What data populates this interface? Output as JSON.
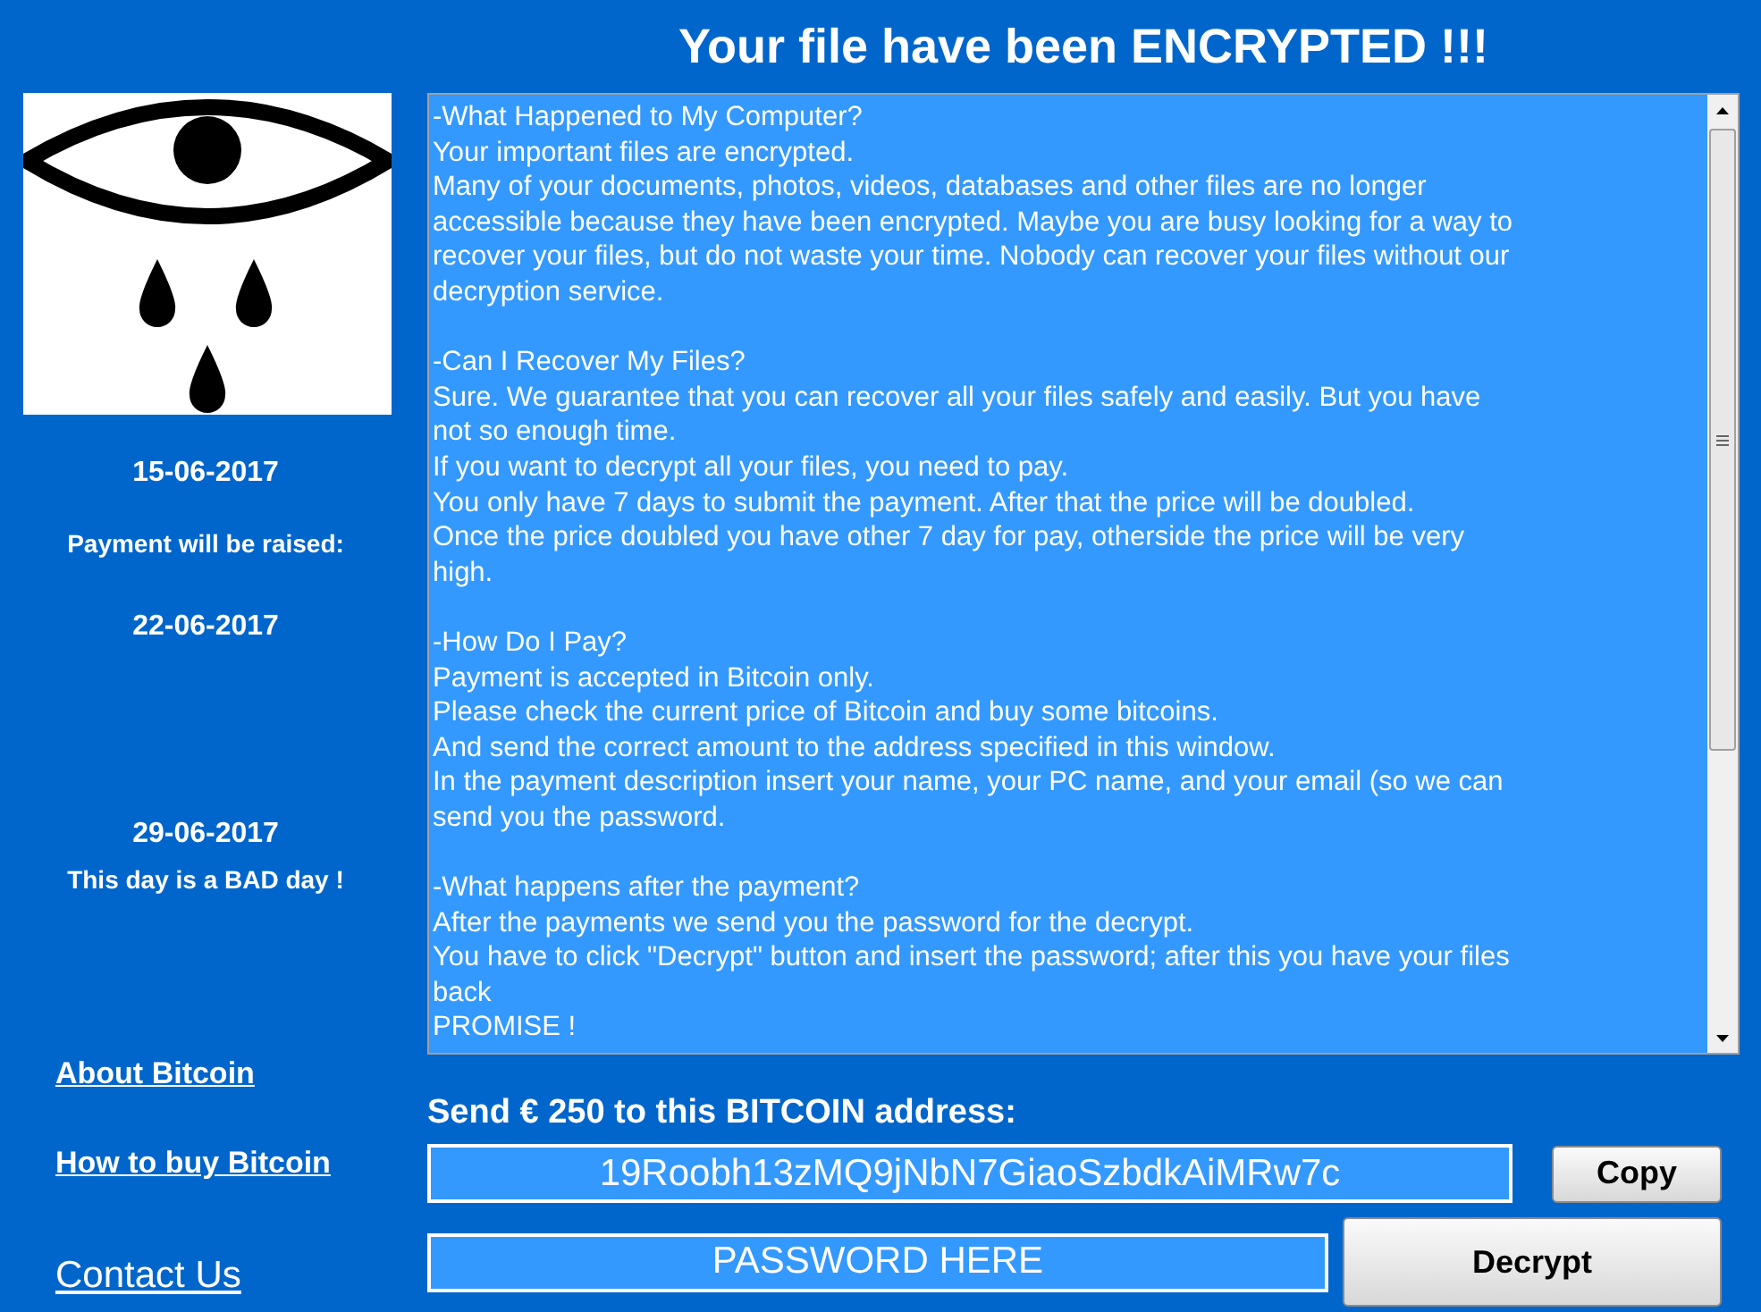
{
  "title": "Your file have been ENCRYPTED !!!",
  "sidebar": {
    "schedule": [
      {
        "kind": "date",
        "text": "15-06-2017"
      },
      {
        "kind": "note",
        "text": "Payment will be raised:"
      },
      {
        "kind": "date",
        "text": "22-06-2017"
      },
      {
        "kind": "date",
        "text": "29-06-2017"
      },
      {
        "kind": "note",
        "text": "This day is a BAD day !"
      }
    ],
    "links": [
      {
        "kind": "small",
        "text": "About Bitcoin"
      },
      {
        "kind": "small",
        "text": "How to buy Bitcoin"
      },
      {
        "kind": "large",
        "text": "Contact Us"
      }
    ]
  },
  "message": {
    "sections": [
      [
        "-What Happened to My Computer?",
        "Your important files are encrypted.",
        "Many of your documents, photos, videos, databases and other files are no longer",
        "accessible because they have been encrypted. Maybe you are busy looking for a way to",
        "recover your files, but do not waste your time. Nobody can recover your files without our",
        "decryption service."
      ],
      [
        "-Can I Recover My Files?",
        "Sure. We guarantee that you can recover all your files safely and easily. But you have",
        "not so enough time.",
        "If you want to decrypt all your files, you need to pay.",
        "You only have 7 days to submit the payment. After that the price will be doubled.",
        "Once the price doubled you have other 7 day for pay, otherside the price will be very",
        "high."
      ],
      [
        "-How Do I Pay?",
        "Payment is accepted in Bitcoin only.",
        "Please check the current price of Bitcoin and buy some bitcoins.",
        "And send the correct amount to the address specified in this window.",
        "In the payment description insert your name, your PC name, and your email (so we can",
        "send you the password."
      ],
      [
        "-What happens after the payment?",
        "After the payments we send you the password for the decrypt.",
        "You have to click \"Decrypt\" button and insert the password; after this you have your files",
        "back",
        "PROMISE !"
      ]
    ]
  },
  "payment": {
    "label": "Send € 250 to this BITCOIN address:",
    "address": "19Roobh13zMQ9jNbN7GiaoSzbdkAiMRw7c",
    "copy_button": "Copy",
    "password": {
      "value": "PASSWORD HERE"
    },
    "decrypt_button": "Decrypt"
  }
}
